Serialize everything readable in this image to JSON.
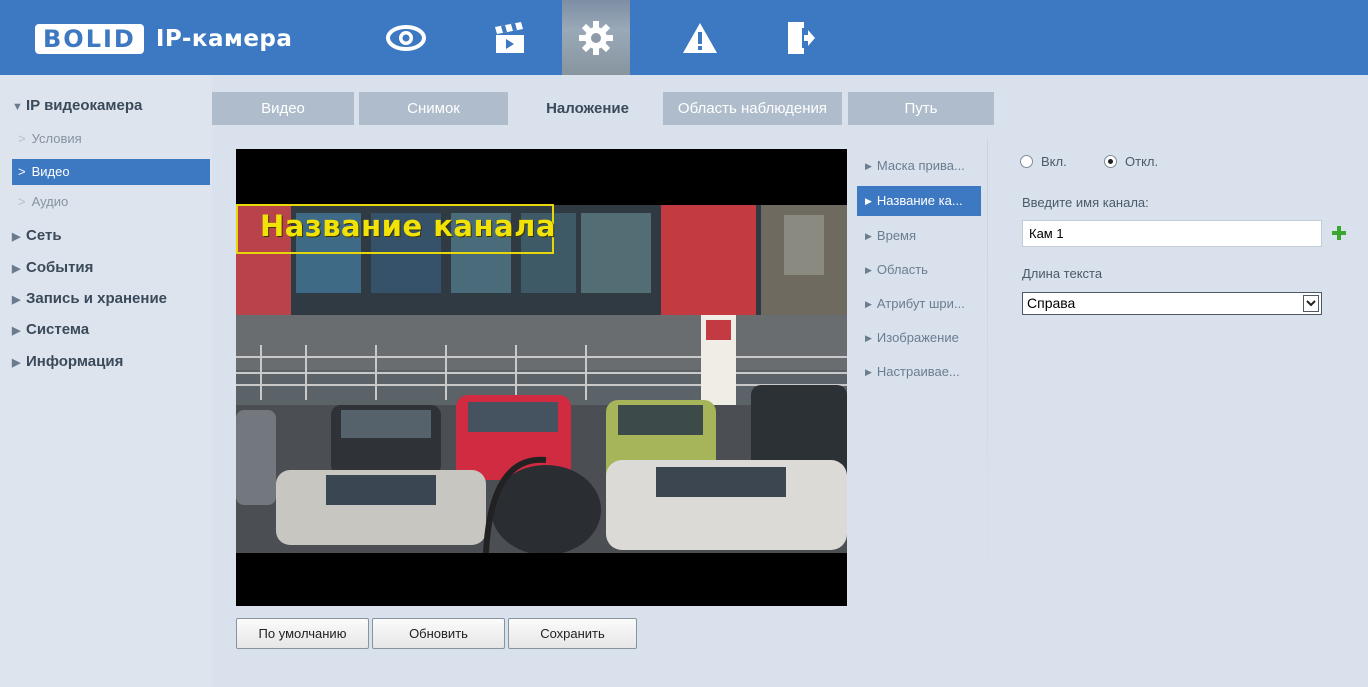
{
  "header": {
    "logo_brand": "BOLID",
    "logo_text": "IP-камера",
    "nav": [
      {
        "icon": "eye-icon",
        "name": "Live view"
      },
      {
        "icon": "clapperboard-icon",
        "name": "Playback"
      },
      {
        "icon": "gear-icon",
        "name": "Settings",
        "active": true
      },
      {
        "icon": "warning-icon",
        "name": "Alarm"
      },
      {
        "icon": "logout-icon",
        "name": "Logout"
      }
    ],
    "colors": {
      "bar": "#3d78c2",
      "active_nav": "#8d9aa8"
    }
  },
  "sidebar": {
    "sections": [
      {
        "label": "IP видеокамера",
        "expanded": true
      },
      {
        "label": "Сеть"
      },
      {
        "label": "События"
      },
      {
        "label": "Запись и хранение"
      },
      {
        "label": "Система"
      },
      {
        "label": "Информация"
      }
    ],
    "subitems": [
      {
        "label": "Условия"
      },
      {
        "label": "Видео",
        "active": true
      },
      {
        "label": "Аудио"
      }
    ]
  },
  "tabs": [
    {
      "label": "Видео"
    },
    {
      "label": "Снимок"
    },
    {
      "label": "Наложение",
      "active": true
    },
    {
      "label": "Область наблюдения"
    },
    {
      "label": "Путь"
    }
  ],
  "video": {
    "osd_text": "Название канала"
  },
  "submenu": [
    {
      "label": "Маска прива..."
    },
    {
      "label": "Название ка...",
      "active": true
    },
    {
      "label": "Время"
    },
    {
      "label": "Область"
    },
    {
      "label": "Атрибут шри..."
    },
    {
      "label": "Изображение"
    },
    {
      "label": "Настраивае..."
    }
  ],
  "settings": {
    "radio_on": "Вкл.",
    "radio_off": "Откл.",
    "selected": "off",
    "channel_name_label": "Введите имя канала:",
    "channel_name_value": "Кам 1",
    "text_align_label": "Длина текста",
    "text_align_value": "Справа"
  },
  "buttons": {
    "default": "По умолчанию",
    "refresh": "Обновить",
    "save": "Сохранить"
  }
}
